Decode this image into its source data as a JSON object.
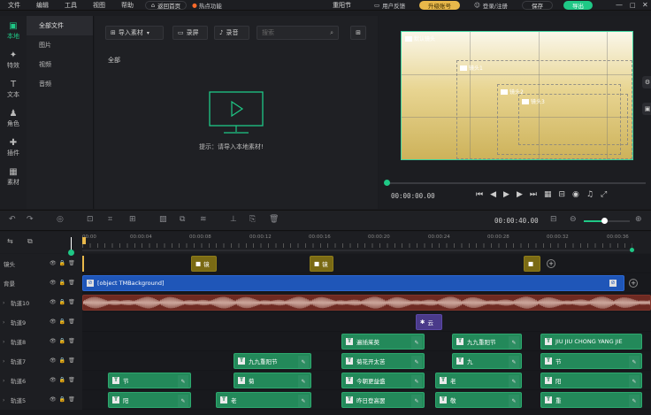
{
  "menubar": {
    "file": "文件",
    "edit": "编辑",
    "tools": "工具",
    "view": "视图",
    "help": "帮助",
    "back_home": "返回首页",
    "hot": "热点功能",
    "project_title": "重阳节",
    "feedback": "用户反馈",
    "upgrade": "升级账号",
    "login": "登录/注册",
    "save": "保存",
    "export": "导出"
  },
  "leftnav": {
    "items": [
      {
        "icon": "▣",
        "label": "本地"
      },
      {
        "icon": "✦",
        "label": "特效"
      },
      {
        "icon": "T",
        "label": "文本"
      },
      {
        "icon": "♟",
        "label": "角色"
      },
      {
        "icon": "✚",
        "label": "插件"
      },
      {
        "icon": "▦",
        "label": "素材"
      }
    ]
  },
  "categories": [
    "全部文件",
    "图片",
    "视频",
    "音频"
  ],
  "media": {
    "import_label": "导入素材",
    "record_screen": "录屏",
    "record_audio": "录音",
    "search_placeholder": "搜索",
    "section": "全部",
    "hint": "提示：请导入本地素材!"
  },
  "preview": {
    "shot_labels": [
      "默认镜头",
      "镜头1",
      "镜头2",
      "镜头3"
    ],
    "time_current": "00:00:00.00"
  },
  "timeline_toolbar": {
    "duration": "00:00:40.00"
  },
  "ruler": {
    "ticks": [
      "00:00",
      "00:00:04",
      "00:00:08",
      "00:00:12",
      "00:00:16",
      "00:00:20",
      "00:00:24",
      "00:00:28",
      "00:00:32",
      "00:00:36"
    ]
  },
  "tracks": [
    {
      "name": "镜头",
      "clips": [
        {
          "type": "yellow",
          "label": "镜"
        },
        {
          "type": "yellow",
          "label": "镜"
        },
        {
          "type": "yellow",
          "label": ""
        }
      ]
    },
    {
      "name": "背景",
      "bg_label": "[object TMBackground]"
    },
    {
      "name": "轨道10",
      "audio": true
    },
    {
      "name": "轨道9",
      "clips": [
        {
          "type": "purple",
          "label": "云"
        }
      ]
    },
    {
      "name": "轨道8",
      "clips": [
        {
          "label": "遍插茱萸"
        },
        {
          "label": "九九重阳节"
        },
        {
          "label": "JIU JIU CHONG YANG JIE"
        }
      ]
    },
    {
      "name": "轨道7",
      "clips": [
        {
          "label": "九九重阳节"
        },
        {
          "label": "菊花开太苦"
        },
        {
          "label": "九"
        },
        {
          "label": "节"
        }
      ]
    },
    {
      "name": "轨道6",
      "clips": [
        {
          "label": "节"
        },
        {
          "label": "菊"
        },
        {
          "label": "今朝更益盛"
        },
        {
          "label": "老"
        },
        {
          "label": "阳"
        }
      ]
    },
    {
      "name": "轨道5",
      "clips": [
        {
          "label": "阳"
        },
        {
          "label": "老"
        },
        {
          "label": "昨日登高罢"
        },
        {
          "label": "敬"
        },
        {
          "label": "重"
        }
      ]
    }
  ]
}
